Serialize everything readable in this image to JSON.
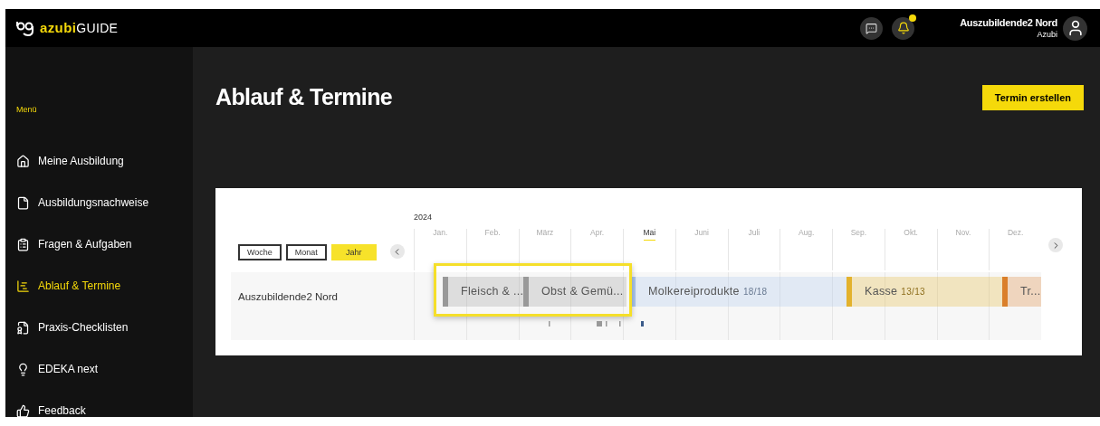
{
  "header": {
    "logo": {
      "brand": "azubi",
      "suffix": "GUIDE"
    },
    "notifications": {
      "unread": true
    },
    "user": {
      "name": "Auszubildende2 Nord",
      "role": "Azubi"
    }
  },
  "sidebar": {
    "title": "Menü",
    "items": [
      {
        "label": "Meine Ausbildung",
        "selected": false
      },
      {
        "label": "Ausbildungsnachweise",
        "selected": false
      },
      {
        "label": "Fragen & Aufgaben",
        "selected": false
      },
      {
        "label": "Ablauf & Termine",
        "selected": true
      },
      {
        "label": "Praxis-Checklisten",
        "selected": false
      },
      {
        "label": "EDEKA next",
        "selected": false
      },
      {
        "label": "Feedback",
        "selected": false
      }
    ]
  },
  "page": {
    "title": "Ablauf & Termine",
    "create_button": "Termin erstellen"
  },
  "timeline": {
    "year": "2024",
    "views": [
      {
        "label": "Woche",
        "selected": false
      },
      {
        "label": "Monat",
        "selected": false
      },
      {
        "label": "Jahr",
        "selected": true
      }
    ],
    "months": [
      {
        "label": "Jan.",
        "selected": false
      },
      {
        "label": "Feb.",
        "selected": false
      },
      {
        "label": "März",
        "selected": false
      },
      {
        "label": "Apr.",
        "selected": false
      },
      {
        "label": "Mai",
        "selected": true
      },
      {
        "label": "Juni",
        "selected": false
      },
      {
        "label": "Juli",
        "selected": false
      },
      {
        "label": "Aug.",
        "selected": false
      },
      {
        "label": "Sep.",
        "selected": false
      },
      {
        "label": "Okt.",
        "selected": false
      },
      {
        "label": "Nov.",
        "selected": false
      },
      {
        "label": "Dez.",
        "selected": false
      }
    ],
    "rows": [
      {
        "name": "Auszubildende2 Nord",
        "bars": [
          {
            "label": "Fleisch & ...",
            "color": "#999999",
            "highlighted": true
          },
          {
            "label": "Obst & Gemü...",
            "color": "#999999",
            "highlighted": true
          },
          {
            "label": "Molkereiprodukte",
            "count": "18/18",
            "color": "#a9c4ec",
            "highlighted": false
          },
          {
            "label": "Kasse",
            "count": "13/13",
            "color": "#e3b22d",
            "highlighted": false
          },
          {
            "label": "Tr...",
            "color": "#da7f2a",
            "highlighted": false
          }
        ]
      }
    ]
  }
}
